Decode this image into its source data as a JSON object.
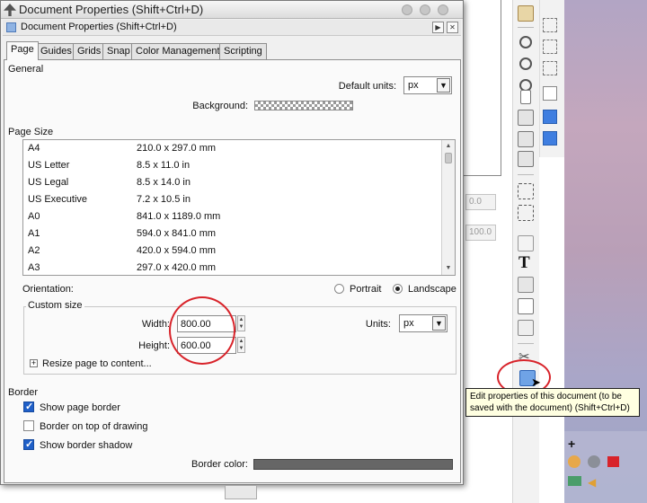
{
  "dialog": {
    "window_title": "Document Properties (Shift+Ctrl+D)",
    "panel_title": "Document Properties (Shift+Ctrl+D)",
    "tabs": [
      "Page",
      "Guides",
      "Grids",
      "Snap",
      "Color Management",
      "Scripting"
    ],
    "active_tab": "Page"
  },
  "general": {
    "heading": "General",
    "default_units_label": "Default units:",
    "default_units_value": "px",
    "background_label": "Background:"
  },
  "page_size": {
    "heading": "Page Size",
    "items": [
      {
        "name": "A4",
        "dims": "210.0 x 297.0 mm"
      },
      {
        "name": "US Letter",
        "dims": "8.5 x 11.0 in"
      },
      {
        "name": "US Legal",
        "dims": "8.5 x 14.0 in"
      },
      {
        "name": "US Executive",
        "dims": "7.2 x 10.5 in"
      },
      {
        "name": "A0",
        "dims": "841.0 x 1189.0 mm"
      },
      {
        "name": "A1",
        "dims": "594.0 x 841.0 mm"
      },
      {
        "name": "A2",
        "dims": "420.0 x 594.0 mm"
      },
      {
        "name": "A3",
        "dims": "297.0 x 420.0 mm"
      }
    ]
  },
  "orientation": {
    "label": "Orientation:",
    "portrait": "Portrait",
    "landscape": "Landscape",
    "selected": "Landscape"
  },
  "custom_size": {
    "heading": "Custom size",
    "width_label": "Width:",
    "width_value": "800.00",
    "height_label": "Height:",
    "height_value": "600.00",
    "units_label": "Units:",
    "units_value": "px",
    "resize_label": "Resize page to content..."
  },
  "border": {
    "heading": "Border",
    "show_page_border": {
      "label": "Show page border",
      "checked": true
    },
    "border_on_top": {
      "label": "Border on top of drawing",
      "checked": false
    },
    "show_border_shadow": {
      "label": "Show border shadow",
      "checked": true
    },
    "border_color_label": "Border color:"
  },
  "canvas": {
    "field_1": "0.0",
    "field_2": "100.0"
  },
  "tooltip": {
    "text": "Edit properties of this document (to be saved with the document) (Shift+Ctrl+D)"
  },
  "toolbar_icons": [
    "document-properties-icon",
    "zoom-icon",
    "text-icon",
    "xml-editor-icon",
    "align-icon"
  ],
  "colors": {
    "annotation_circle": "#d8232a",
    "checkbox_checked": "#1f5fc8",
    "snap_active": "#3f7ee0",
    "border_color": "#666666",
    "tooltip_bg": "#ffffe1"
  }
}
